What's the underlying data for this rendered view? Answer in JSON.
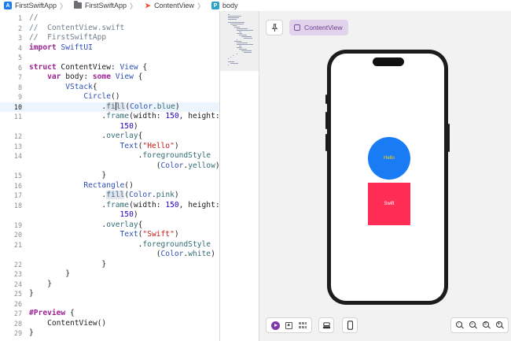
{
  "breadcrumb": {
    "items": [
      {
        "label": "FirstSwiftApp",
        "icon": "app-icon"
      },
      {
        "label": "FirstSwiftApp",
        "icon": "folder-icon"
      },
      {
        "label": "ContentView",
        "icon": "swift-file-icon"
      },
      {
        "label": "body",
        "icon": "property-icon"
      }
    ],
    "separator": "〉"
  },
  "editor": {
    "current_line": 10,
    "lines": [
      {
        "n": "1",
        "text": "//"
      },
      {
        "n": "2",
        "text": "//  ContentView.swift"
      },
      {
        "n": "3",
        "text": "//  FirstSwiftApp"
      },
      {
        "n": "4",
        "text": "import SwiftUI"
      },
      {
        "n": "5",
        "text": ""
      },
      {
        "n": "6",
        "text": "struct ContentView: View {"
      },
      {
        "n": "7",
        "text": "    var body: some View {"
      },
      {
        "n": "8",
        "text": "        VStack{"
      },
      {
        "n": "9",
        "text": "            Circle()"
      },
      {
        "n": "10",
        "text": "                .fill(Color.blue)"
      },
      {
        "n": "11",
        "text": "                .frame(width: 150, height:"
      },
      {
        "n": "",
        "text": "                    150)"
      },
      {
        "n": "12",
        "text": "                .overlay{"
      },
      {
        "n": "13",
        "text": "                    Text(\"Hello\")"
      },
      {
        "n": "14",
        "text": "                        .foregroundStyle"
      },
      {
        "n": "",
        "text": "                            (Color.yellow)"
      },
      {
        "n": "15",
        "text": "                }"
      },
      {
        "n": "16",
        "text": "            Rectangle()"
      },
      {
        "n": "17",
        "text": "                .fill(Color.pink)"
      },
      {
        "n": "18",
        "text": "                .frame(width: 150, height:"
      },
      {
        "n": "",
        "text": "                    150)"
      },
      {
        "n": "19",
        "text": "                .overlay{"
      },
      {
        "n": "20",
        "text": "                    Text(\"Swift\")"
      },
      {
        "n": "21",
        "text": "                        .foregroundStyle"
      },
      {
        "n": "",
        "text": "                            (Color.white)"
      },
      {
        "n": "22",
        "text": "                }"
      },
      {
        "n": "23",
        "text": "        }"
      },
      {
        "n": "24",
        "text": "    }"
      },
      {
        "n": "25",
        "text": "}"
      },
      {
        "n": "26",
        "text": ""
      },
      {
        "n": "27",
        "text": "#Preview {"
      },
      {
        "n": "28",
        "text": "    ContentView()"
      },
      {
        "n": "29",
        "text": "}"
      }
    ]
  },
  "canvas": {
    "pin_icon": "pin-icon",
    "preview_tab_label": "ContentView",
    "circle_text": "Hello",
    "rect_text": "Swift",
    "colors": {
      "circle": "#1a7cf5",
      "circle_text": "#ffd60a",
      "rect": "#ff2d55",
      "rect_text": "#ffffff"
    },
    "toolbar": {
      "left_icons": [
        "live-preview-icon",
        "selectable-mode-icon",
        "variants-icon"
      ],
      "device_settings_icon": "device-settings-icon",
      "device_icon": "device-icon",
      "zoom_icons": [
        "zoom-fit-icon",
        "zoom-out-icon",
        "zoom-100-icon",
        "zoom-in-icon"
      ]
    }
  }
}
